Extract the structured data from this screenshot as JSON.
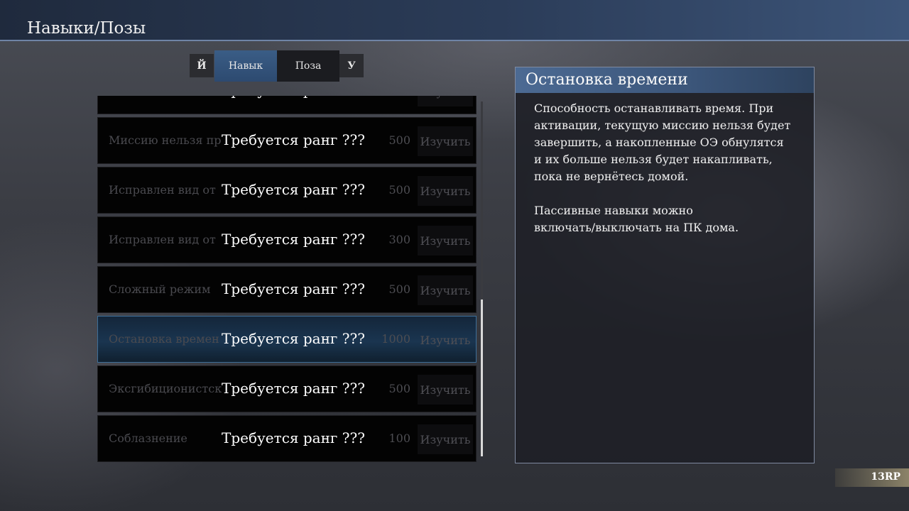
{
  "page": {
    "title": "Навыки/Позы"
  },
  "tabs": {
    "left_key": "Й",
    "right_key": "У",
    "items": [
      {
        "label": "Навык",
        "active": true
      },
      {
        "label": "Поза",
        "active": false
      }
    ]
  },
  "skills": {
    "lock_text": "Требуется ранг ???",
    "learn_label": "Изучить",
    "rows": [
      {
        "name": "",
        "cost": "",
        "selected": false
      },
      {
        "name": "Миссию нельзя пр",
        "cost": "500",
        "selected": false
      },
      {
        "name": "Исправлен вид от",
        "cost": "500",
        "selected": false
      },
      {
        "name": "Исправлен вид от",
        "cost": "300",
        "selected": false
      },
      {
        "name": "Сложный режим",
        "cost": "500",
        "selected": false
      },
      {
        "name": "Остановка времен",
        "cost": "1000",
        "selected": true
      },
      {
        "name": "Эксгибиционистск",
        "cost": "500",
        "selected": false
      },
      {
        "name": "Соблазнение",
        "cost": "100",
        "selected": false
      }
    ]
  },
  "detail": {
    "title": "Остановка времени",
    "description": "Способность останавливать время. При\nактивации, текущую миссию нельзя будет\nзавершить, а накопленные ОЭ обнулятся\nи их больше нельзя будет накапливать,\nпока не вернётесь домой.\n\nПассивные навыки можно\nвключать/выключать на ПК дома."
  },
  "footer": {
    "rp": "13RP"
  },
  "colors": {
    "accent": "#3a5d86",
    "selected_border": "#3d6e98"
  }
}
